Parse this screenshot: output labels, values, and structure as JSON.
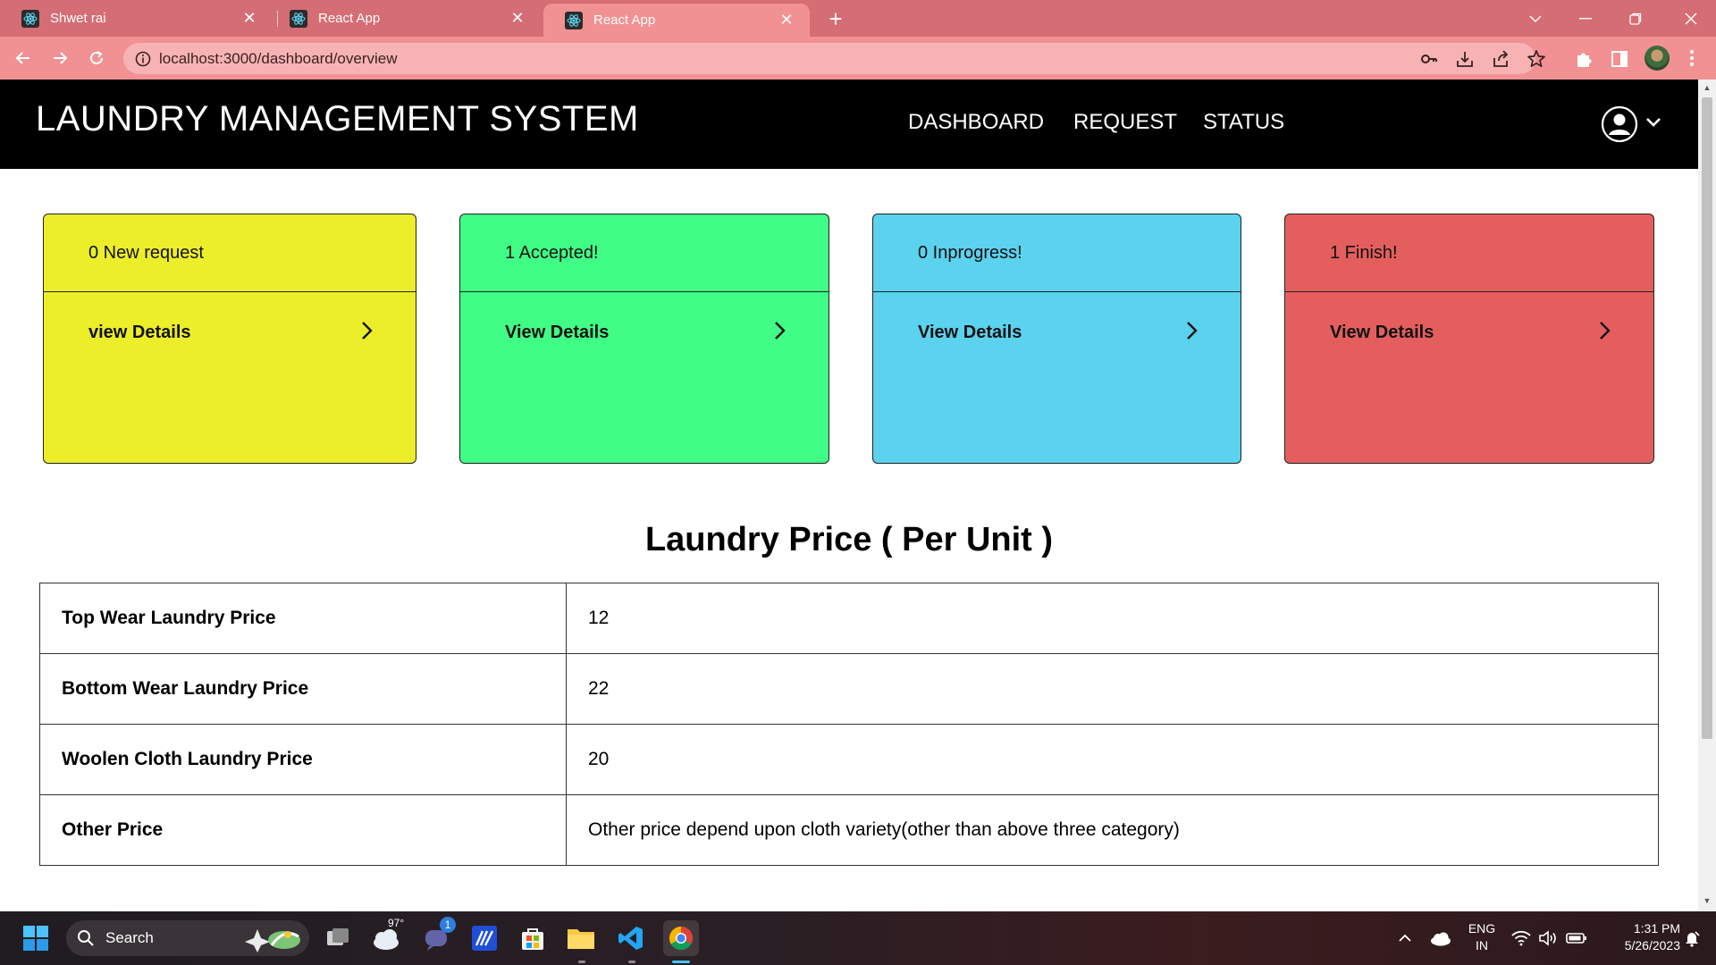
{
  "browser": {
    "tabs": [
      {
        "title": "Shwet rai"
      },
      {
        "title": "React App"
      },
      {
        "title": "React App"
      }
    ],
    "url": "localhost:3000/dashboard/overview"
  },
  "app": {
    "brand": "LAUNDRY MANAGEMENT SYSTEM",
    "menu": [
      "DASHBOARD",
      "REQUEST",
      "STATUS"
    ]
  },
  "cards": [
    {
      "header": "0 New request",
      "link": "view Details",
      "color": "#edee2a"
    },
    {
      "header": "1 Accepted!",
      "link": "View Details",
      "color": "#40fd86"
    },
    {
      "header": "0 Inprogress!",
      "link": "View Details",
      "color": "#5bd2ee"
    },
    {
      "header": "1 Finish!",
      "link": "View Details",
      "color": "#e55e5e"
    }
  ],
  "price_section": {
    "title": "Laundry Price ( Per Unit )",
    "rows": [
      {
        "label": "Top Wear Laundry Price",
        "value": "12"
      },
      {
        "label": "Bottom Wear Laundry Price",
        "value": "22"
      },
      {
        "label": "Woolen Cloth Laundry Price",
        "value": "20"
      },
      {
        "label": "Other Price",
        "value": "Other price depend upon cloth variety(other than above three category)"
      }
    ]
  },
  "taskbar": {
    "search_label": "Search",
    "weather_temp": "97°",
    "teams_badge": "1",
    "lang_top": "ENG",
    "lang_bottom": "IN",
    "time": "1:31 PM",
    "date": "5/26/2023"
  }
}
